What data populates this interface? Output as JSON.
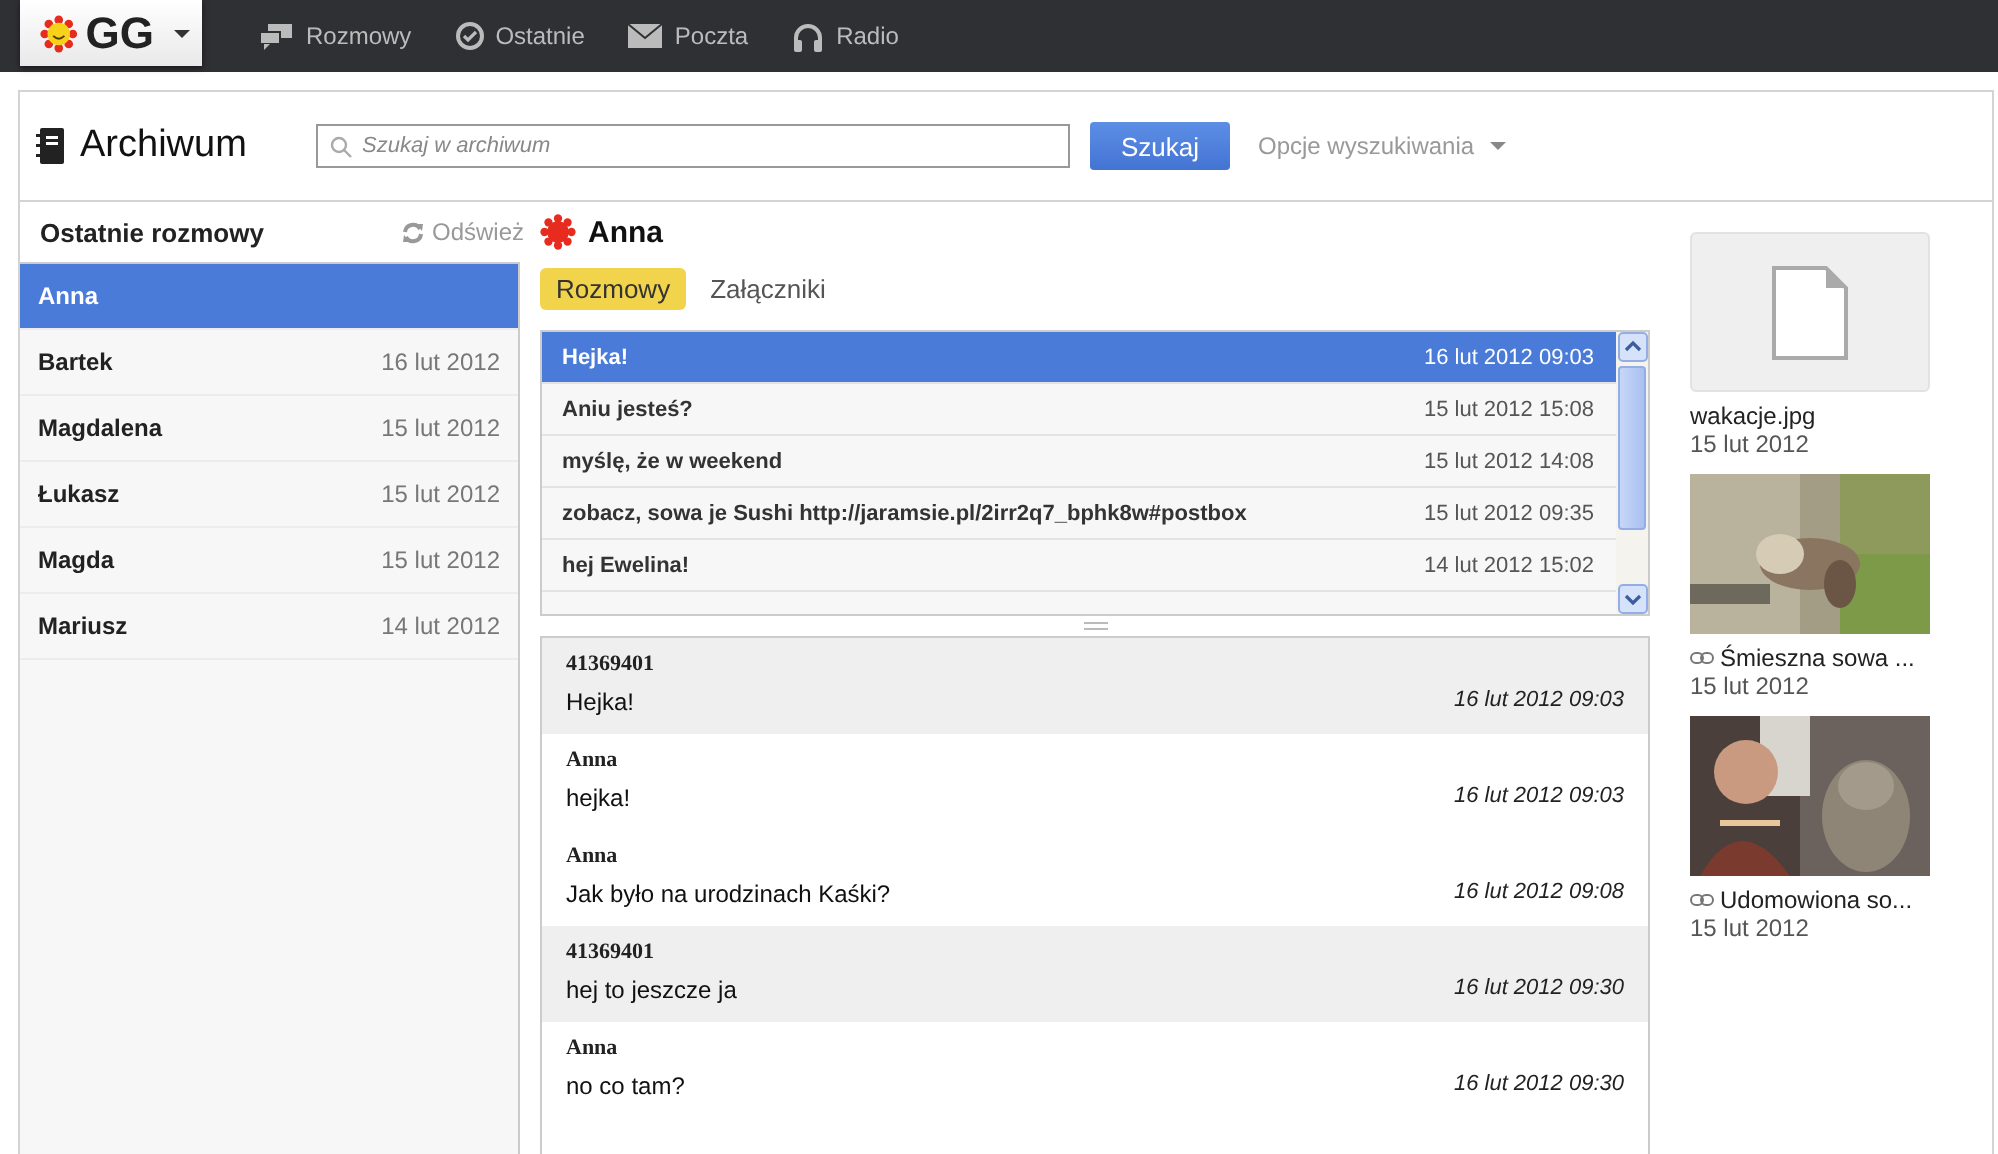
{
  "topbar": {
    "logo": "GG",
    "nav": [
      {
        "label": "Rozmowy"
      },
      {
        "label": "Ostatnie"
      },
      {
        "label": "Poczta"
      },
      {
        "label": "Radio"
      }
    ]
  },
  "header": {
    "title": "Archiwum",
    "search": {
      "placeholder": "Szukaj w archiwum"
    },
    "search_button": "Szukaj",
    "options": "Opcje wyszukiwania"
  },
  "sidebar": {
    "title": "Ostatnie rozmowy",
    "refresh": "Odśwież",
    "items": [
      {
        "name": "Anna",
        "selected": true
      },
      {
        "name": "Bartek",
        "date": "16 lut 2012",
        "selected": false
      },
      {
        "name": "Magdalena",
        "date": "15 lut 2012",
        "selected": false
      },
      {
        "name": "Łukasz",
        "date": "15 lut 2012",
        "selected": false
      },
      {
        "name": "Magda",
        "date": "15 lut 2012",
        "selected": false
      },
      {
        "name": "Mariusz",
        "date": "14 lut 2012",
        "selected": false
      }
    ]
  },
  "contact": {
    "name": "Anna"
  },
  "tabs": [
    {
      "label": "Rozmowy",
      "selected": true
    },
    {
      "label": "Załączniki",
      "selected": false
    }
  ],
  "threads": [
    {
      "text": "Hejka!",
      "date": "16 lut 2012 09:03",
      "selected": true
    },
    {
      "text": "Aniu jesteś?",
      "date": "15 lut 2012 15:08",
      "selected": false
    },
    {
      "text": "myślę, że w weekend",
      "date": "15 lut 2012 14:08",
      "selected": false
    },
    {
      "text": "zobacz, sowa je Sushi http://jaramsie.pl/2irr2q7_bphk8w#postbox",
      "date": "15 lut 2012 09:35",
      "selected": false
    },
    {
      "text": "hej Ewelina!",
      "date": "14 lut 2012 15:02",
      "selected": false
    }
  ],
  "messages": [
    {
      "author": "41369401",
      "text": "Hejka!",
      "date": "16 lut 2012 09:03",
      "own": true
    },
    {
      "author": "Anna",
      "text": "hejka!",
      "date": "16 lut 2012 09:03",
      "own": false
    },
    {
      "author": "Anna",
      "text": "Jak było na urodzinach Kaśki?",
      "date": "16 lut 2012 09:08",
      "own": false
    },
    {
      "author": "41369401",
      "text": "hej to jeszcze ja",
      "date": "16 lut 2012 09:30",
      "own": true
    },
    {
      "author": "Anna",
      "text": "no co tam?",
      "date": "16 lut 2012 09:30",
      "own": false
    }
  ],
  "attachments": [
    {
      "kind": "file",
      "title": "wakacje.jpg",
      "date": "15 lut 2012"
    },
    {
      "kind": "link",
      "title": "Śmieszna sowa ...",
      "date": "15 lut 2012"
    },
    {
      "kind": "link",
      "title": "Udomowiona so...",
      "date": "15 lut 2012"
    }
  ]
}
